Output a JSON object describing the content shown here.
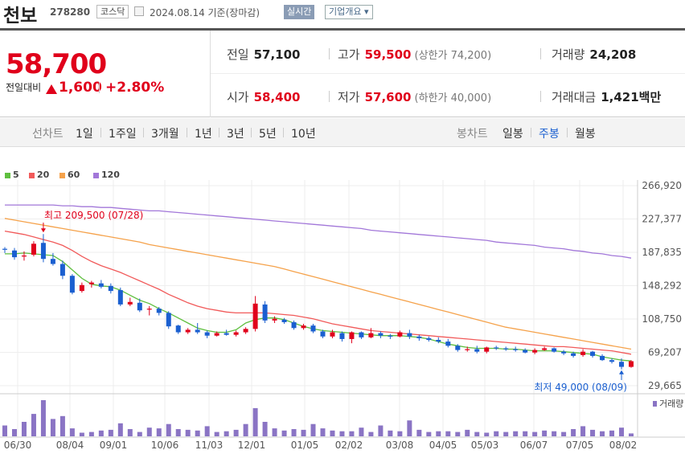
{
  "stock": {
    "name": "천보",
    "code": "278280",
    "market": "코스닥",
    "date_label": "2024.08.14 기준(장마감)",
    "realtime_button": "실시간",
    "info_button": "기업개요 ▾"
  },
  "price": {
    "current": "58,700",
    "compare_label": "전일대비",
    "change": "1,600",
    "change_pct": "+2.80%"
  },
  "stats": {
    "prev_label": "전일",
    "prev": "57,100",
    "high_label": "고가",
    "high": "59,500",
    "upper_limit": "(상한가 74,200)",
    "volume_label": "거래량",
    "volume": "24,208",
    "open_label": "시가",
    "open": "58,400",
    "low_label": "저가",
    "low": "57,600",
    "lower_limit": "(하한가 40,000)",
    "amount_label": "거래대금",
    "amount": "1,421",
    "amount_unit": "백만"
  },
  "tabs": {
    "line_label": "선차트",
    "line_items": [
      "1일",
      "1주일",
      "3개월",
      "1년",
      "3년",
      "5년",
      "10년"
    ],
    "candle_label": "봉차트",
    "candle_items": [
      "일봉",
      "주봉",
      "월봉"
    ],
    "candle_selected": "주봉"
  },
  "colors": {
    "up": "#e0001b",
    "down": "#1a5fd0",
    "ma5": "#5fbf3f",
    "ma20": "#f15a5a",
    "ma60": "#f5a24b",
    "ma120": "#a277d9",
    "volume": "#8a74c4"
  },
  "chart_data": {
    "type": "candlestick",
    "interval": "weekly",
    "legend": [
      {
        "name": "5",
        "color": "#5fbf3f"
      },
      {
        "name": "20",
        "color": "#f15a5a"
      },
      {
        "name": "60",
        "color": "#f5a24b"
      },
      {
        "name": "120",
        "color": "#a277d9"
      }
    ],
    "y_ticks": [
      "266,920",
      "227,377",
      "187,835",
      "148,292",
      "108,750",
      "69,207",
      "29,665"
    ],
    "ylim": [
      29665,
      266920
    ],
    "x_ticks": [
      "06/30",
      "08/04",
      "09/01",
      "10/06",
      "11/03",
      "12/01",
      "01/05",
      "02/02",
      "03/08",
      "04/05",
      "05/03",
      "06/07",
      "07/05",
      "08/02"
    ],
    "volume_label": "거래량",
    "annotations": {
      "high": "최고 209,500 (07/28)",
      "low": "최저 49,000 (08/09)"
    },
    "candles": [
      [
        192000,
        194000,
        187000,
        191000
      ],
      [
        190000,
        193000,
        179000,
        182000
      ],
      [
        183000,
        189000,
        178000,
        184000
      ],
      [
        185000,
        201000,
        183000,
        198000
      ],
      [
        199000,
        209500,
        176000,
        180000
      ],
      [
        180000,
        187000,
        172000,
        174000
      ],
      [
        174000,
        178000,
        156000,
        160000
      ],
      [
        160000,
        162000,
        138000,
        140000
      ],
      [
        142000,
        152000,
        140000,
        149000
      ],
      [
        150000,
        154000,
        146000,
        152000
      ],
      [
        151000,
        155000,
        145000,
        147000
      ],
      [
        148000,
        151000,
        139000,
        142000
      ],
      [
        143000,
        146000,
        124000,
        126000
      ],
      [
        126000,
        134000,
        124000,
        129000
      ],
      [
        128000,
        133000,
        117000,
        119000
      ],
      [
        120000,
        124000,
        113000,
        121000
      ],
      [
        121000,
        123000,
        113000,
        116000
      ],
      [
        116000,
        118000,
        97000,
        100000
      ],
      [
        101000,
        102000,
        91000,
        93000
      ],
      [
        93000,
        98000,
        91000,
        96000
      ],
      [
        96000,
        104000,
        91000,
        93000
      ],
      [
        93000,
        95000,
        86000,
        89000
      ],
      [
        89000,
        94000,
        88000,
        92000
      ],
      [
        92000,
        96000,
        89000,
        90000
      ],
      [
        90000,
        95000,
        88000,
        93000
      ],
      [
        93000,
        99000,
        91000,
        97000
      ],
      [
        97000,
        136000,
        94000,
        127000
      ],
      [
        126000,
        130000,
        104000,
        107000
      ],
      [
        107000,
        112000,
        104000,
        109000
      ],
      [
        108000,
        110000,
        103000,
        105000
      ],
      [
        105000,
        107000,
        96000,
        98000
      ],
      [
        98000,
        103000,
        96000,
        101000
      ],
      [
        101000,
        103000,
        92000,
        94000
      ],
      [
        94000,
        96000,
        86000,
        88000
      ],
      [
        88000,
        96000,
        86000,
        93000
      ],
      [
        92000,
        94000,
        82000,
        85000
      ],
      [
        85000,
        94000,
        80000,
        93000
      ],
      [
        93000,
        94000,
        85000,
        87000
      ],
      [
        87000,
        98000,
        86000,
        92000
      ],
      [
        92000,
        94000,
        86000,
        89000
      ],
      [
        89000,
        91000,
        85000,
        88000
      ],
      [
        88000,
        95000,
        87000,
        93000
      ],
      [
        92000,
        96000,
        85000,
        88000
      ],
      [
        88000,
        90000,
        83000,
        86000
      ],
      [
        86000,
        88000,
        82000,
        84000
      ],
      [
        84000,
        87000,
        80000,
        82000
      ],
      [
        82000,
        85000,
        75000,
        77000
      ],
      [
        77000,
        79000,
        70000,
        72000
      ],
      [
        72000,
        76000,
        70000,
        73000
      ],
      [
        73000,
        77000,
        68000,
        70000
      ],
      [
        70000,
        76000,
        68000,
        75000
      ],
      [
        75000,
        77000,
        72000,
        74000
      ],
      [
        74000,
        76000,
        71000,
        73000
      ],
      [
        73000,
        76000,
        70000,
        72000
      ],
      [
        72000,
        74000,
        68000,
        69000
      ],
      [
        69000,
        74000,
        67000,
        72000
      ],
      [
        72000,
        76000,
        71000,
        74000
      ],
      [
        74000,
        75000,
        69000,
        70000
      ],
      [
        70000,
        72000,
        66000,
        68000
      ],
      [
        68000,
        70000,
        63000,
        65000
      ],
      [
        66000,
        73000,
        64000,
        70000
      ],
      [
        70000,
        71000,
        63000,
        65000
      ],
      [
        65000,
        67000,
        59000,
        60000
      ],
      [
        60000,
        62000,
        56000,
        58000
      ],
      [
        58000,
        62000,
        49000,
        52000
      ],
      [
        52000,
        60000,
        51000,
        58700
      ]
    ],
    "ma5": [
      186000,
      186000,
      187000,
      186000,
      185000,
      184000,
      177000,
      167000,
      157000,
      150000,
      148000,
      147000,
      143000,
      137000,
      131000,
      127000,
      121000,
      116000,
      110000,
      104000,
      98000,
      95000,
      93000,
      93000,
      96000,
      104000,
      108000,
      110000,
      110000,
      108000,
      104000,
      100000,
      97000,
      95000,
      94000,
      93000,
      92000,
      91000,
      90000,
      89000,
      89000,
      89000,
      88000,
      87000,
      85000,
      82000,
      79000,
      77000,
      75000,
      74000,
      74000,
      74000,
      73000,
      73000,
      72000,
      71000,
      71000,
      71000,
      70000,
      69000,
      68000,
      67000,
      64000,
      62000,
      60000,
      59000
    ],
    "ma20": [
      213000,
      211000,
      209000,
      206000,
      203000,
      200000,
      196000,
      190000,
      183000,
      177000,
      172000,
      168000,
      164000,
      159000,
      154000,
      149000,
      144000,
      138000,
      133000,
      128000,
      124000,
      121000,
      119000,
      117000,
      116000,
      116000,
      116000,
      116000,
      115000,
      114000,
      113000,
      111000,
      109000,
      106000,
      103000,
      101000,
      99000,
      97000,
      95000,
      94000,
      93000,
      92000,
      91000,
      90000,
      89000,
      88000,
      87000,
      86000,
      85000,
      84000,
      83000,
      82000,
      81000,
      80000,
      79000,
      78000,
      77000,
      76000,
      76000,
      75000,
      74000,
      73000,
      72000,
      71000,
      69000,
      67000
    ],
    "ma60": [
      228000,
      226000,
      224000,
      222000,
      220000,
      218000,
      216000,
      214000,
      212000,
      210000,
      208000,
      206000,
      204000,
      202000,
      200000,
      197000,
      195000,
      193000,
      191000,
      189000,
      187000,
      185000,
      183000,
      181000,
      179000,
      177000,
      175000,
      173000,
      171000,
      168000,
      165000,
      162000,
      159000,
      156000,
      153000,
      150000,
      147000,
      144000,
      141000,
      138000,
      135000,
      132000,
      129000,
      126000,
      123000,
      120000,
      117000,
      114000,
      111000,
      108000,
      105000,
      102000,
      99000,
      97000,
      95000,
      93000,
      91000,
      89000,
      87000,
      85000,
      83000,
      81000,
      79000,
      77000,
      75000,
      73000
    ],
    "ma120": [
      244000,
      244000,
      244000,
      244000,
      244000,
      244000,
      243000,
      243000,
      242000,
      242000,
      241000,
      241000,
      240000,
      239000,
      238000,
      237000,
      237000,
      236000,
      235000,
      234000,
      233000,
      232000,
      231000,
      230000,
      229000,
      228000,
      227000,
      226000,
      225000,
      224000,
      223000,
      222000,
      221000,
      220000,
      219000,
      218000,
      217000,
      216000,
      214000,
      213000,
      212000,
      211000,
      210000,
      209000,
      208000,
      207000,
      206000,
      205000,
      204000,
      203000,
      202000,
      200000,
      199000,
      198000,
      197000,
      196000,
      194000,
      193000,
      192000,
      190000,
      189000,
      187000,
      186000,
      184000,
      183000,
      181000
    ],
    "volume": [
      30,
      20,
      40,
      62,
      100,
      48,
      56,
      22,
      10,
      12,
      16,
      18,
      36,
      20,
      12,
      24,
      22,
      34,
      20,
      18,
      16,
      28,
      12,
      14,
      18,
      34,
      78,
      40,
      22,
      16,
      20,
      18,
      34,
      22,
      16,
      14,
      14,
      24,
      12,
      30,
      16,
      14,
      44,
      18,
      12,
      14,
      14,
      12,
      18,
      12,
      10,
      14,
      12,
      14,
      14,
      12,
      16,
      14,
      12,
      20,
      28,
      18,
      14,
      16,
      24,
      8
    ]
  }
}
